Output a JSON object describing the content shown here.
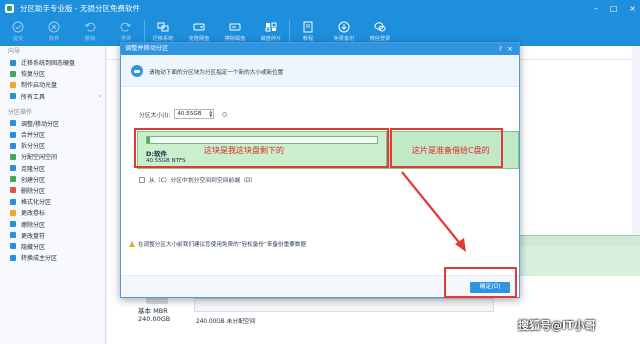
{
  "window": {
    "title": "分区助手专业版 - 无损分区免费软件",
    "controls": [
      "minimize",
      "maximize",
      "close"
    ]
  },
  "toolbar": {
    "items": [
      {
        "label": "提交",
        "icon": "check-icon",
        "enabled": false
      },
      {
        "label": "放弃",
        "icon": "cancel-icon",
        "enabled": false
      },
      {
        "label": "撤销",
        "icon": "undo-icon",
        "enabled": false
      },
      {
        "label": "重做",
        "icon": "redo-icon",
        "enabled": false
      },
      {
        "label": "迁移系统",
        "icon": "migrate-icon",
        "enabled": true
      },
      {
        "label": "克隆硬盘",
        "icon": "clone-disk-icon",
        "enabled": true
      },
      {
        "label": "擦除磁盘",
        "icon": "wipe-disk-icon",
        "enabled": true
      },
      {
        "label": "磁盘碎片",
        "icon": "defrag-icon",
        "enabled": true
      },
      {
        "label": "教程",
        "icon": "book-icon",
        "enabled": true
      },
      {
        "label": "免费备份",
        "icon": "backup-icon",
        "enabled": true
      },
      {
        "label": "微信登录",
        "icon": "wechat-icon",
        "enabled": true
      }
    ]
  },
  "sidebar": {
    "section1": "向导",
    "items1": [
      {
        "label": "迁移系统到固态硬盘",
        "icon": "migrate-icon"
      },
      {
        "label": "恢复分区",
        "icon": "restore-icon"
      },
      {
        "label": "制作启动光盘",
        "icon": "disc-icon"
      },
      {
        "label": "所有工具",
        "icon": "tools-icon",
        "arrow": "›"
      }
    ],
    "section2": "分区操作",
    "items2": [
      {
        "label": "调整/移动分区",
        "icon": "resize-icon"
      },
      {
        "label": "合并分区",
        "icon": "merge-icon"
      },
      {
        "label": "拆分分区",
        "icon": "split-icon"
      },
      {
        "label": "分配空闲空间",
        "icon": "allocate-icon"
      },
      {
        "label": "克隆分区",
        "icon": "clone-icon"
      },
      {
        "label": "创建分区",
        "icon": "create-icon"
      },
      {
        "label": "删除分区",
        "icon": "delete-icon"
      },
      {
        "label": "格式化分区",
        "icon": "format-icon"
      },
      {
        "label": "更改卷标",
        "icon": "label-icon"
      },
      {
        "label": "擦除分区",
        "icon": "wipe-icon"
      },
      {
        "label": "更改盘符",
        "icon": "letter-icon"
      },
      {
        "label": "隐藏分区",
        "icon": "hide-icon"
      },
      {
        "label": "转换成主分区",
        "icon": "convert-icon"
      }
    ]
  },
  "disk": {
    "type": "基本 MBR",
    "size": "240.00GB",
    "bar_text": "240.00GB 未分配空间"
  },
  "dialog": {
    "title": "调整并移动分区",
    "help": "?",
    "close": "×",
    "instruction": "请拖动下面的分区块为分区指定一个新的大小或新位置",
    "size_label": "分区大小(I):",
    "size_value": "40.55GB",
    "partition": {
      "name": "D:软件",
      "info": "40.55GB NTFS"
    },
    "checkbox_label": "从（C）分区中划分空间到空间前端（D）",
    "warning": "在调整分区大小前我们建议您使用免费的“轻松备份”来备份重要数据",
    "ok_label": "确定(O)",
    "annotation_left": "这块是我这块盘剩下的",
    "annotation_right": "这片是准备借给C盘的"
  },
  "watermark": "搜狐号@IT小哥",
  "colors": {
    "accent": "#1e8fdd",
    "annotation": "#e23a36",
    "partition_fill": "#c9efcc"
  }
}
